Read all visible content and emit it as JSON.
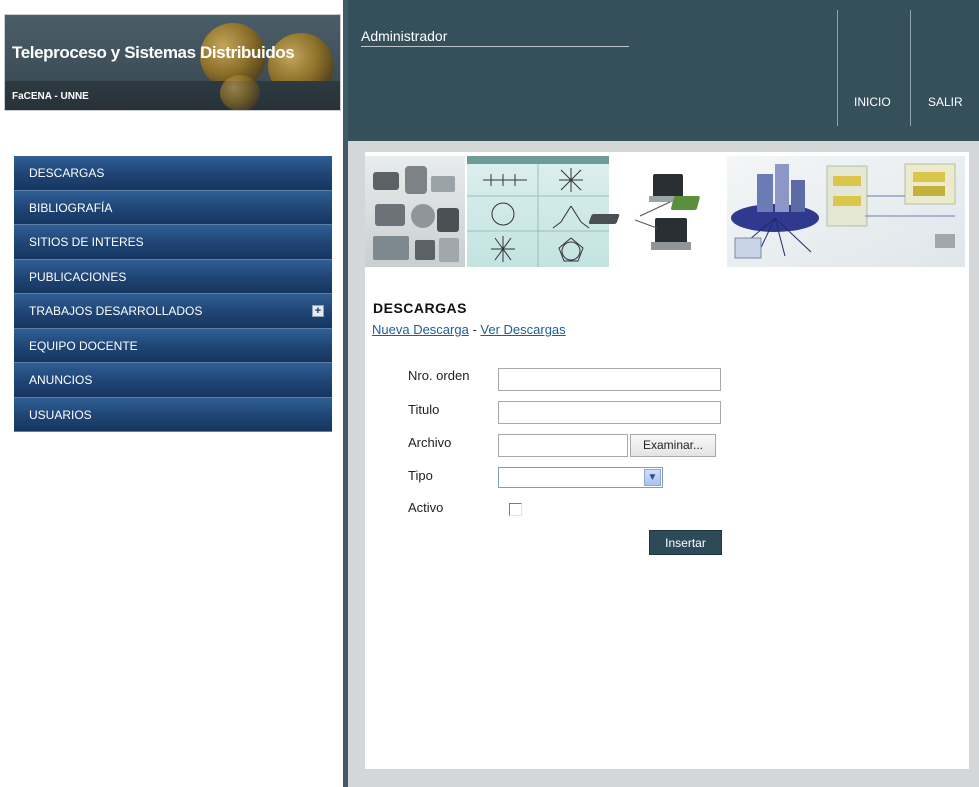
{
  "header": {
    "site_title": "Teleproceso y Sistemas Distribuidos",
    "site_subtitle": "FaCENA - UNNE",
    "user_label": "Administrador",
    "nav": {
      "home": "INICIO",
      "logout": "SALIR"
    }
  },
  "sidebar": {
    "items": [
      {
        "label": "DESCARGAS"
      },
      {
        "label": "BIBLIOGRAFÍA"
      },
      {
        "label": "SITIOS DE INTERES"
      },
      {
        "label": "PUBLICACIONES"
      },
      {
        "label": "TRABAJOS DESARROLLADOS",
        "expand_icon": "+"
      },
      {
        "label": "EQUIPO DOCENTE"
      },
      {
        "label": "ANUNCIOS"
      },
      {
        "label": "USUARIOS"
      }
    ]
  },
  "main": {
    "section_title": "DESCARGAS",
    "links": {
      "new": "Nueva Descarga",
      "separator": " - ",
      "view": "Ver Descargas"
    },
    "form": {
      "order_label": "Nro. orden",
      "order_value": "",
      "title_label": "Titulo",
      "title_value": "",
      "file_label": "Archivo",
      "browse_button": "Examinar...",
      "type_label": "Tipo",
      "type_value": "",
      "active_label": "Activo",
      "active_checked": false,
      "submit_button": "Insertar"
    }
  },
  "colors": {
    "topbar": "#35505b",
    "menu": "#1f4474",
    "link": "#1c5d9b",
    "button": "#2d4a58"
  },
  "icons": [
    "globe-icon",
    "chevron-down-icon",
    "plus-icon"
  ]
}
